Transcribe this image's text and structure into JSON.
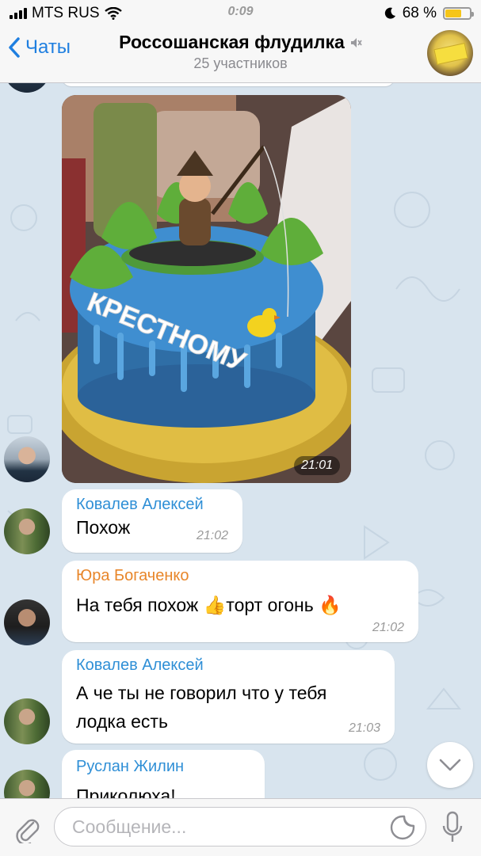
{
  "status_bar": {
    "carrier": "MTS RUS",
    "time": "0:09",
    "battery_percent": "68 %",
    "battery_level": 0.68
  },
  "nav": {
    "back_label": "Чаты",
    "title": "Россошанская флудилка",
    "subtitle": "25 участников"
  },
  "photo_message": {
    "time": "21:01",
    "cake_text": "КРЕСТНОМУ"
  },
  "messages": [
    {
      "sender": "Ковалев Алексей",
      "sender_color": "#2f8fd6",
      "text": "Похож",
      "time": "21:02"
    },
    {
      "sender": "Юра Богаченко",
      "sender_color": "#e8862a",
      "text": "На тебя похож 👍торт огонь 🔥",
      "time": "21:02"
    },
    {
      "sender": "Ковалев Алексей",
      "sender_color": "#2f8fd6",
      "text_lines": [
        "А че ты не говорил что у тебя",
        "лодка есть"
      ],
      "time": "21:03"
    },
    {
      "sender": "Руслан Жилин",
      "sender_color": "#2f8fd6",
      "text": "Приколюха!"
    }
  ],
  "input": {
    "placeholder": "Сообщение..."
  },
  "colors": {
    "accent": "#1f7fe0",
    "chat_background": "#d8e4ee"
  },
  "icons": [
    "back-chevron-icon",
    "mute-icon",
    "wifi-icon",
    "moon-icon",
    "attach-icon",
    "sticker-icon",
    "microphone-icon",
    "chevron-down-icon"
  ]
}
